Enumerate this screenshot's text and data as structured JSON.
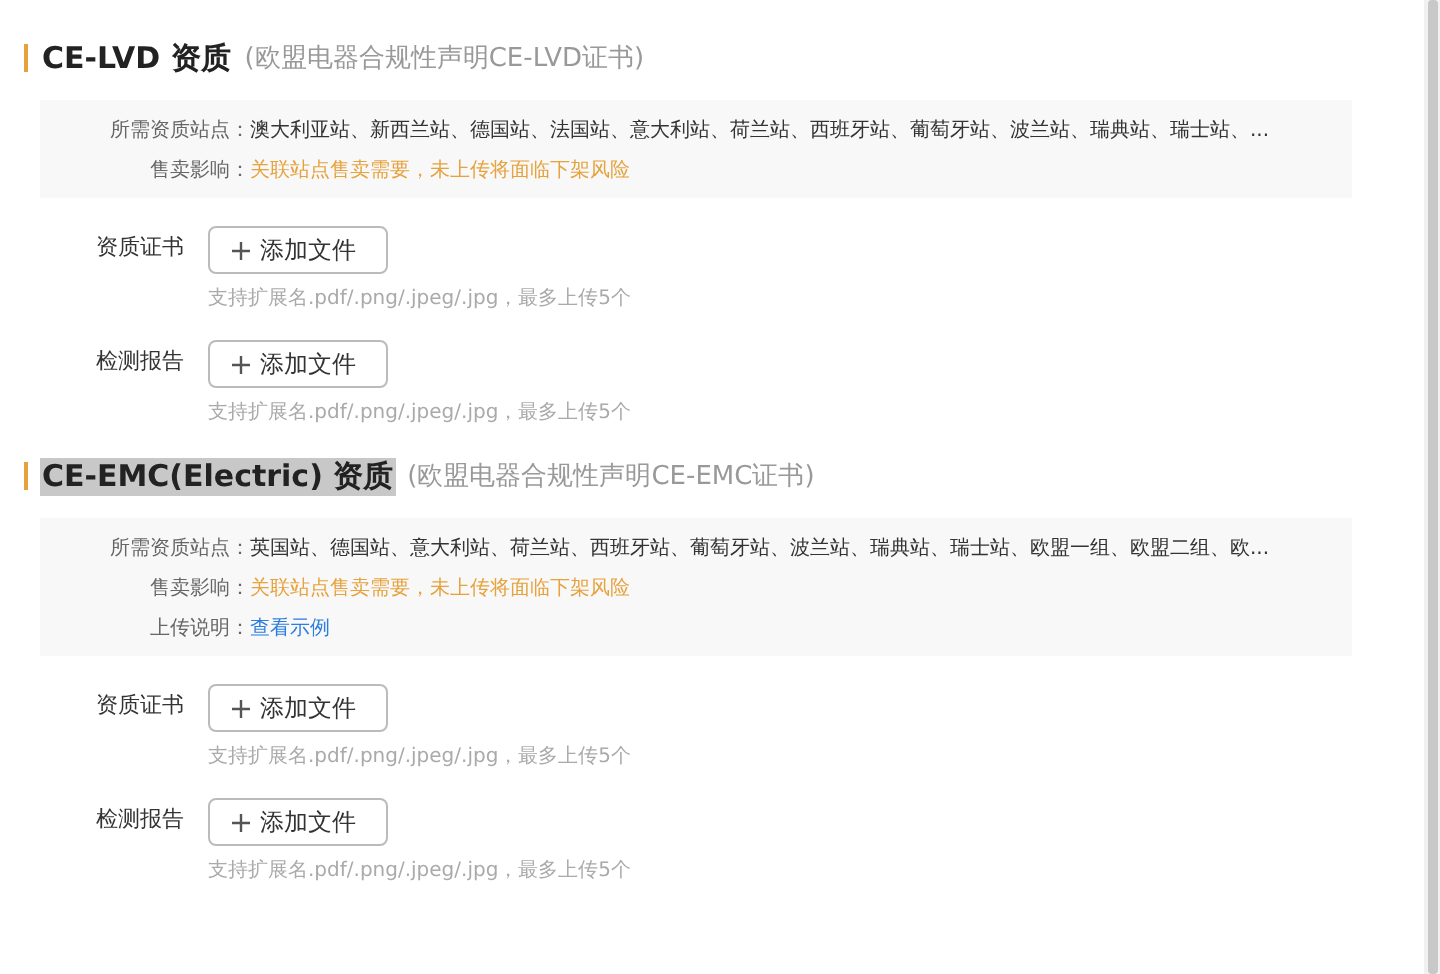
{
  "sections": [
    {
      "title": "CE-LVD 资质",
      "highlighted": false,
      "subtitle": "(欧盟电器合规性声明CE-LVD证书)",
      "info": [
        {
          "label": "所需资质站点：",
          "kind": "text",
          "value": "澳大利亚站、新西兰站、德国站、法国站、意大利站、荷兰站、西班牙站、葡萄牙站、波兰站、瑞典站、瑞士站、..."
        },
        {
          "label": "售卖影响：",
          "kind": "warning",
          "value": "关联站点售卖需要，未上传将面临下架风险"
        }
      ],
      "fields": [
        {
          "label": "资质证书",
          "button": "添加文件",
          "hint": "支持扩展名.pdf/.png/.jpeg/.jpg，最多上传5个"
        },
        {
          "label": "检测报告",
          "button": "添加文件",
          "hint": "支持扩展名.pdf/.png/.jpeg/.jpg，最多上传5个"
        }
      ]
    },
    {
      "title": "CE-EMC(Electric) 资质",
      "highlighted": true,
      "subtitle": "(欧盟电器合规性声明CE-EMC证书)",
      "info": [
        {
          "label": "所需资质站点：",
          "kind": "text",
          "value": "英国站、德国站、意大利站、荷兰站、西班牙站、葡萄牙站、波兰站、瑞典站、瑞士站、欧盟一组、欧盟二组、欧..."
        },
        {
          "label": "售卖影响：",
          "kind": "warning",
          "value": "关联站点售卖需要，未上传将面临下架风险"
        },
        {
          "label": "上传说明：",
          "kind": "link",
          "value": "查看示例"
        }
      ],
      "fields": [
        {
          "label": "资质证书",
          "button": "添加文件",
          "hint": "支持扩展名.pdf/.png/.jpeg/.jpg，最多上传5个"
        },
        {
          "label": "检测报告",
          "button": "添加文件",
          "hint": "支持扩展名.pdf/.png/.jpeg/.jpg，最多上传5个"
        }
      ]
    }
  ]
}
